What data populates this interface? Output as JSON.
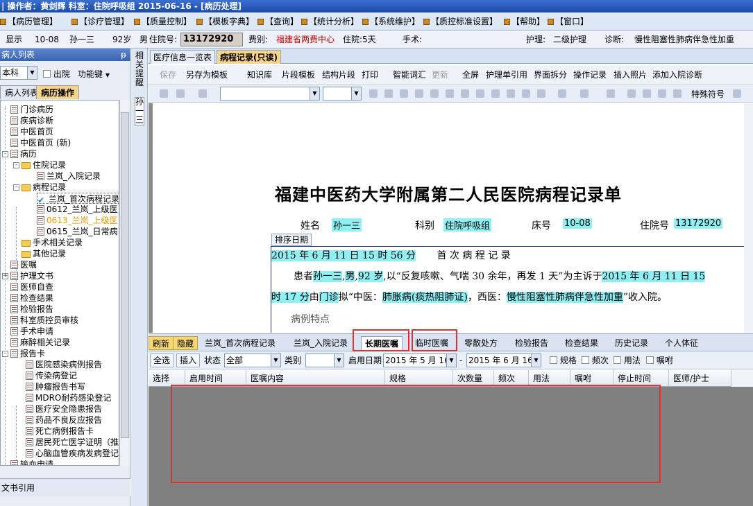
{
  "titlebar": {
    "text": "| 操作者：黄剑辉   科室：住院呼吸组   2015-06-16 - [病历处理]"
  },
  "menu": [
    "【病历管理】",
    "【诊疗管理】",
    "【质量控制】",
    "【模板字典】",
    "【查询】",
    "【统计分析】",
    "【系统维护】",
    "【质控标准设置】",
    "【帮助】",
    "【窗口】"
  ],
  "patient": {
    "show": "显示",
    "bed": "10-08",
    "name": "孙一三",
    "age": "92岁",
    "sex_label": "男",
    "no_label": "住院号:",
    "no": "13172920",
    "type_label": "费别:",
    "type": "福建省两费中心",
    "stay": "住院:5天",
    "surgery": "手术:",
    "care_label": "护理:",
    "care": "二级护理",
    "diag_label": "诊断:",
    "diag": "慢性阻塞性肺病伴急性加重"
  },
  "left": {
    "header": "病人列表",
    "pin": "ᵽ",
    "dept": "本科",
    "discharge": "出院",
    "func": "功能键",
    "tabs": [
      "病人列表",
      "病历操作"
    ],
    "tree": [
      "门诊病历",
      "疾病诊断",
      "中医首页",
      "中医首页 (新)",
      "病历",
      "住院记录",
      "兰岚_入院记录",
      "病程记录",
      "兰岚_首次病程记录",
      "0612_兰岚_上级医",
      "0613_兰岚_上级医",
      "0615_兰岚_日常病",
      "手术相关记录",
      "其他记录",
      "医嘱",
      "护理文书",
      "医师自查",
      "检查结果",
      "检验报告",
      "科室质控员审核",
      "手术申请",
      "麻醉相关记录",
      "报告卡",
      "医院感染病例报告",
      "传染病登记",
      "肿瘤报告书写",
      "MDRO耐药感染登记",
      "医疗安全隐患报告",
      "药品不良反应报告",
      "死亡病例报告卡",
      "居民死亡医学证明（推",
      "心脑血管疾病发病登记",
      "输血申请"
    ],
    "bottom": "文书引用"
  },
  "side": {
    "text1": "相关提醒",
    "text2": "孙一三"
  },
  "doctabs": [
    "医疗信息一览表",
    "病程记录(只读)"
  ],
  "toolbar": [
    "保存",
    "另存为模板",
    "知识库",
    "片段模板",
    "结构片段",
    "打印",
    "智能词汇",
    "更新",
    "全屏",
    "护理单引用",
    "界面拆分",
    "操作记录",
    "插入照片",
    "添加入院诊断"
  ],
  "toolbar2": {
    "special": "特殊符号"
  },
  "document": {
    "title": "福建中医药大学附属第二人民医院病程记录单",
    "name_label": "姓名",
    "name": "孙一三",
    "dept_label": "科别",
    "dept": "住院呼吸组",
    "bed_label": "床号",
    "bed": "10-08",
    "no_label": "住院号",
    "no": "13172920",
    "sort_label": "排序日期",
    "l1_date": "2015 年 6 月 11 日 15 时 56 分",
    "l1_title": "首  次  病  程  记  录",
    "l2a": "患者",
    "l2b": "孙一三",
    "l2c": ",",
    "l2d": "男",
    ",": ",",
    "l2e": "92 岁",
    "l2f": ",以“反复咳嗽、气喘 30 余年，再发 1 天”为主诉于",
    "l2g": "2015 年 6 月 11 日 15",
    "l3a": "时 17 分",
    "l3b": "由",
    "l3c": "门诊",
    "l3d": "拟“中医：",
    "l3e": "肺胀病(痰热阻肺证)",
    "l3f": "，西医：",
    "l3g": "慢性阻塞性肺病伴急性加重",
    "l3h": "”收入院。",
    "l4": "病例特点"
  },
  "bottomtabs": [
    "刷新",
    "隐藏",
    "兰岚_首次病程记录",
    "兰岚_入院记录",
    "长期医嘱",
    "临时医嘱",
    "零散处方",
    "检验报告",
    "检查结果",
    "历史记录",
    "个人体征"
  ],
  "filter": {
    "select_all": "全选",
    "insert": "插入",
    "status_label": "状态",
    "status": "全部",
    "category_label": "类别",
    "date_label": "启用日期",
    "date_from": "2015 年 5 月 16",
    "dash": "-",
    "date_to": "2015 年 6 月 16",
    "opts": [
      "规格",
      "频次",
      "用法",
      "嘱咐"
    ]
  },
  "columns": [
    "选择",
    "启用时间",
    "医嘱内容",
    "规格",
    "次数量",
    "频次",
    "用法",
    "嘱咐",
    "停止时间",
    "医师/护士"
  ]
}
